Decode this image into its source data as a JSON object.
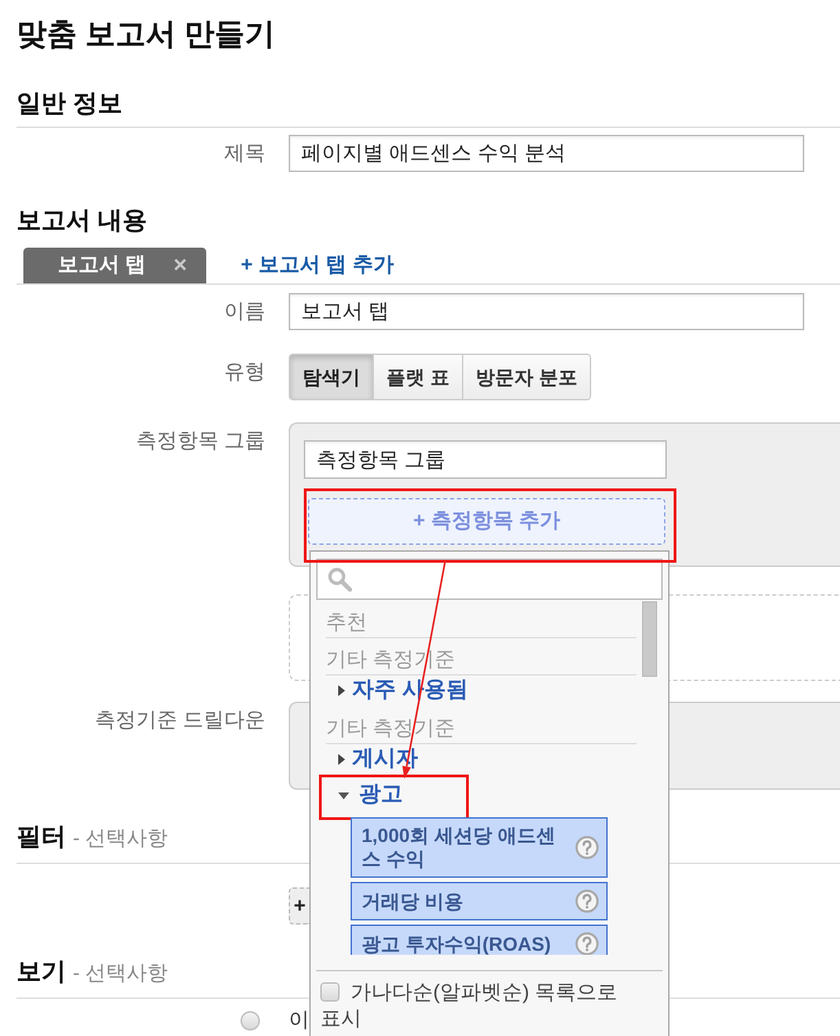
{
  "page_title": "맞춤 보고서 만들기",
  "general": {
    "heading": "일반 정보",
    "title_label": "제목",
    "title_value": "페이지별 애드센스 수익 분석"
  },
  "content": {
    "heading": "보고서 내용",
    "tabs": [
      {
        "label": "보고서 탭",
        "close": "×",
        "selected": true
      }
    ],
    "add_tab": "+ 보고서 탭 추가",
    "name_label": "이름",
    "name_value": "보고서 탭",
    "type_label": "유형",
    "types": [
      {
        "label": "탐색기",
        "selected": true
      },
      {
        "label": "플랫 표",
        "selected": false
      },
      {
        "label": "방문자 분포",
        "selected": false
      }
    ],
    "metric_group_label": "측정항목 그룹",
    "metric_group_value": "측정항목 그룹",
    "add_metric": {
      "label": "+ 측정항목 추가",
      "highlighted": true
    },
    "drilldown_label": "측정기준 드릴다운"
  },
  "filter": {
    "heading": "필터",
    "note": "- 선택사항",
    "add_button": "+"
  },
  "view": {
    "heading": "보기",
    "note": "- 선택사항",
    "options": [
      {
        "label": "이",
        "selected": false
      }
    ]
  },
  "metric_menu": {
    "entries": [
      {
        "kind": "header",
        "label": "추천"
      },
      {
        "kind": "header",
        "label": "기타 측정기준"
      },
      {
        "kind": "category",
        "label": "자주 사용됨",
        "expanded": false,
        "highlighted": false
      },
      {
        "kind": "header",
        "label": "기타 측정기준"
      },
      {
        "kind": "category",
        "label": "게시자",
        "expanded": false,
        "highlighted": false
      },
      {
        "kind": "category",
        "label": "광고",
        "expanded": true,
        "highlighted": true,
        "children": [
          {
            "label": "1,000회 세션당 애드센스 수익"
          },
          {
            "label": "거래당 비용"
          },
          {
            "label": "광고 투자수익(ROAS)"
          }
        ]
      }
    ],
    "alphabetical": {
      "label": "가나다순(알파벳순) 목록으로 표시",
      "checked": false
    }
  }
}
